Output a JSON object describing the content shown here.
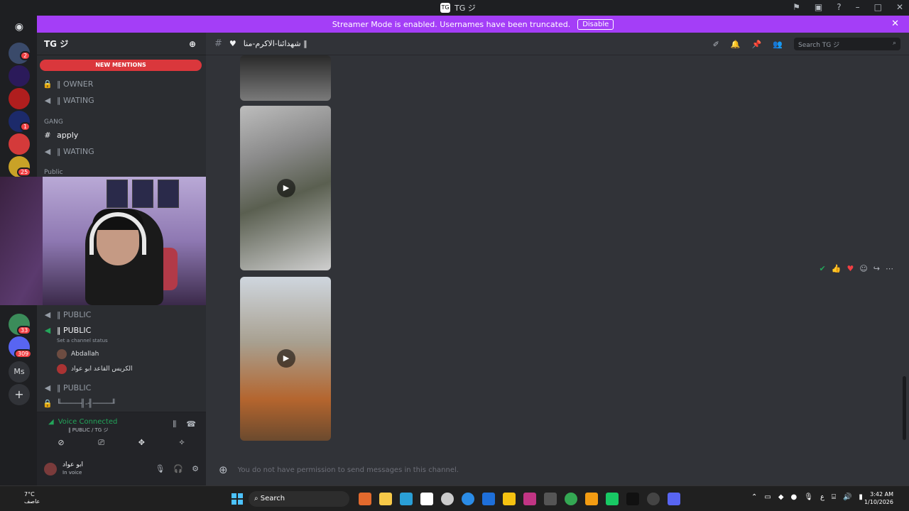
{
  "window": {
    "title": "TG ジ"
  },
  "banner": {
    "text": "Streamer Mode is enabled. Usernames have been truncated.",
    "disable_label": "Disable",
    "color": "#a43ef7"
  },
  "rail": {
    "badges": [
      "2",
      "1",
      "25",
      "33",
      "309",
      "1"
    ],
    "ms_label": "Ms"
  },
  "server": {
    "name": "TG ジ",
    "new_mentions": "NEW MENTIONS"
  },
  "channels": {
    "owner_cat": "OWNER",
    "owner": "‖ OWNER",
    "wating1": "‖ WATING",
    "gang_cat": "GANG",
    "apply": "apply",
    "wating2": "‖ WATING",
    "public_cat": "Public",
    "public1": "‖ PUBLIC",
    "public2": "‖ PUBLIC",
    "set_status": "Set a channel status",
    "member1": "Abdallah",
    "member2": "الكريس القاعد ابو عواد",
    "public3": "‖ PUBLIC",
    "bottom": "╙────╢-╢────╜"
  },
  "voice": {
    "status": "Voice Connected",
    "sub": "‖ PUBLIC / TG ジ"
  },
  "user": {
    "name": "ابو عواد",
    "status": "In voice"
  },
  "channel_header": {
    "name": "شهدائنا-الاكرم-منا ‖",
    "search_placeholder": "Search TG ジ"
  },
  "composer": {
    "placeholder": "You do not have permission to send messages in this channel."
  },
  "taskbar": {
    "weather_temp": "7°C",
    "weather_desc": "عاصف",
    "search": "Search",
    "time": "3:42 AM",
    "date": "1/10/2026"
  }
}
